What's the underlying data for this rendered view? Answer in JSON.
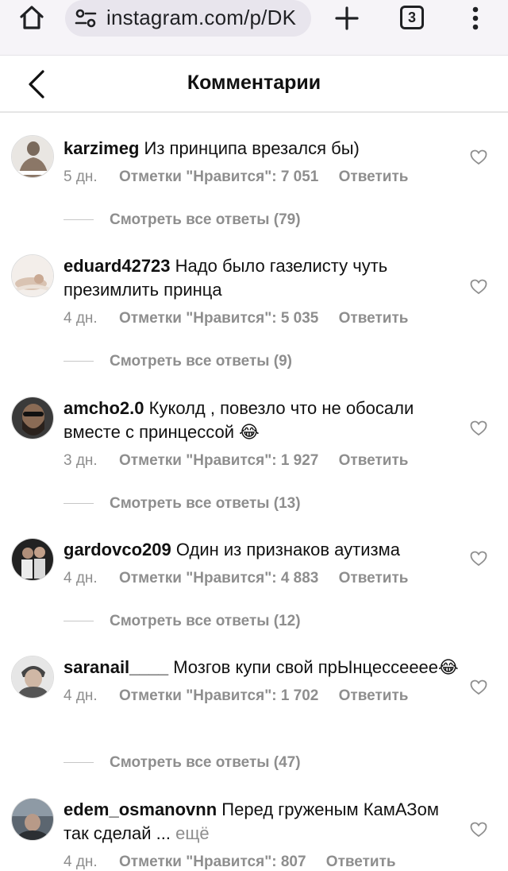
{
  "browser": {
    "url": "instagram.com/p/DK",
    "tab_count": "3"
  },
  "header": {
    "title": "Комментарии"
  },
  "labels": {
    "likes_prefix": "Отметки \"Нравится\": ",
    "reply": "Ответить"
  },
  "comments": [
    {
      "user": "karzimeg",
      "text": "Из принципа врезался бы)",
      "time": "5 дн.",
      "likes": "Отметки \"Нравится\": 7 051",
      "reply": "Ответить",
      "replies": "Смотреть все ответы (79)"
    },
    {
      "user": "eduard42723",
      "text": "Надо было газелисту чуть презимлить принца",
      "time": "4 дн.",
      "likes": "Отметки \"Нравится\": 5 035",
      "reply": "Ответить",
      "replies": "Смотреть все ответы (9)"
    },
    {
      "user": "amcho2.0",
      "text": "Куколд , повезло что не обосали вместе с принцессой 😂",
      "time": "3 дн.",
      "likes": "Отметки \"Нравится\": 1 927",
      "reply": "Ответить",
      "replies": "Смотреть все ответы (13)"
    },
    {
      "user": "gardovco209",
      "text": "Один из признаков аутизма",
      "time": "4 дн.",
      "likes": "Отметки \"Нравится\": 4 883",
      "reply": "Ответить",
      "replies": "Смотреть все ответы (12)"
    },
    {
      "user": "saranail____",
      "text": "Мозгов купи свой прЫнцессееее😂",
      "time": "4 дн.",
      "likes": "Отметки \"Нравится\": 1 702",
      "reply": "Ответить",
      "replies": "Смотреть все ответы (47)"
    },
    {
      "user": "edem_osmanovnn",
      "text": "Перед груженым КамАЗом так сделай ...",
      "more": "ещё",
      "time": "4 дн.",
      "likes": "Отметки \"Нравится\": 807",
      "reply": "Ответить"
    }
  ]
}
